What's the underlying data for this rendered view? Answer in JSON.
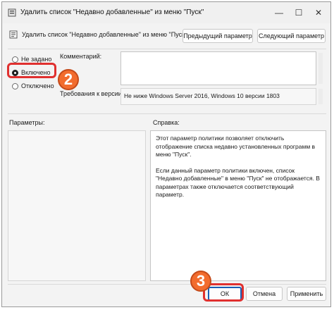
{
  "window": {
    "title": "Удалить список \"Недавно добавленные\" из меню \"Пуск\"",
    "minimize_glyph": "—",
    "maximize_glyph": "☐",
    "close_glyph": "✕"
  },
  "header": {
    "policy_name": "Удалить список \"Недавно добавленные\" из меню \"Пуск\"",
    "prev_button": "Предыдущий параметр",
    "next_button": "Следующий параметр"
  },
  "state": {
    "options": [
      {
        "label": "Не задано",
        "checked": false
      },
      {
        "label": "Включено",
        "checked": true
      },
      {
        "label": "Отключено",
        "checked": false
      }
    ]
  },
  "comment": {
    "label": "Комментарий:",
    "value": ""
  },
  "supported": {
    "label": "Требования к версии:",
    "value": "Не ниже Windows Server 2016, Windows 10 версии 1803"
  },
  "params": {
    "label": "Параметры:"
  },
  "help": {
    "label": "Справка:",
    "paragraphs": [
      "Этот параметр политики позволяет отключить отображение списка недавно установленных программ в меню \"Пуск\".",
      "Если данный параметр политики включен, список \"Недавно добавленные\" в меню \"Пуск\" не отображается.  В параметрах также отключается соответствующий параметр."
    ]
  },
  "footer": {
    "ok": "ОК",
    "cancel": "Отмена",
    "apply": "Применить"
  },
  "annotations": {
    "step2": "2",
    "step3": "3"
  },
  "colors": {
    "highlight": "#e0302f",
    "badge": "#f26c2e"
  }
}
